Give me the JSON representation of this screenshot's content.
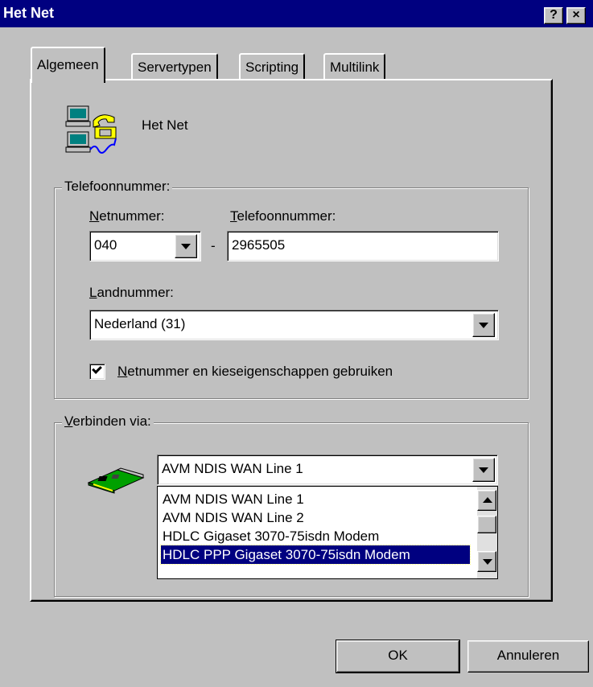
{
  "window": {
    "title": "Het Net",
    "help_label": "?",
    "close_label": "×"
  },
  "tabs": [
    {
      "label": "Algemeen",
      "active": true
    },
    {
      "label": "Servertypen",
      "active": false
    },
    {
      "label": "Scripting",
      "active": false
    },
    {
      "label": "Multilink",
      "active": false
    }
  ],
  "connection": {
    "icon": "dialup-network-icon",
    "name": "Het Net"
  },
  "phone_group": {
    "label": "Telefoonnummer:",
    "area_code_label_first": "N",
    "area_code_label_rest": "etnummer:",
    "area_code_value": "040",
    "separator": "-",
    "phone_label_first": "T",
    "phone_label_rest": "elefoonnummer:",
    "phone_value": "2965505",
    "country_label_first": "L",
    "country_label_rest": "andnummer:",
    "country_value": "Nederland (31)",
    "checkbox_checked": true,
    "checkbox_label_first": "N",
    "checkbox_label_mid": "e",
    "checkbox_label_rest": "tnummer en kieseigenschappen gebruiken"
  },
  "connect_group": {
    "label_first": "V",
    "label_rest": "erbinden via:",
    "device_icon": "modem-card-icon",
    "selected_value": "AVM NDIS WAN Line 1",
    "options": [
      {
        "label": "AVM NDIS WAN Line 1",
        "selected": false
      },
      {
        "label": "AVM NDIS WAN Line 2",
        "selected": false
      },
      {
        "label": "HDLC Gigaset 3070-75isdn Modem",
        "selected": false
      },
      {
        "label": "HDLC PPP Gigaset 3070-75isdn Modem",
        "selected": true
      }
    ]
  },
  "buttons": {
    "ok": "OK",
    "cancel": "Annuleren"
  }
}
